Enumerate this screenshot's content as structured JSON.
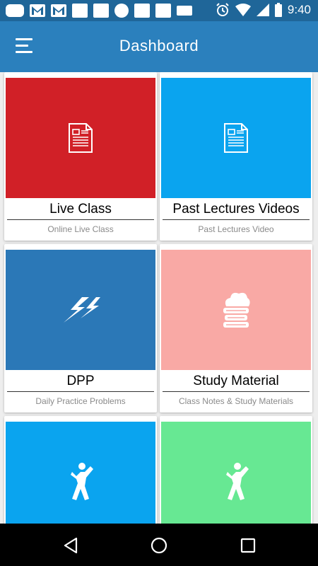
{
  "status_bar": {
    "time": "9:40",
    "notification_icons": [
      "chat-icon",
      "gmail-icon",
      "gmail-icon",
      "square-icon",
      "square-icon",
      "circle-icon",
      "square-icon",
      "square-icon",
      "square-icon"
    ],
    "system_icons": [
      "alarm-icon",
      "wifi-icon",
      "signal-icon",
      "battery-icon"
    ]
  },
  "app_bar": {
    "title": "Dashboard",
    "color": "#2b80bd"
  },
  "cards": [
    {
      "title": "Live Class",
      "subtitle": "Online Live Class",
      "color": "#d12027",
      "icon": "document-icon"
    },
    {
      "title": "Past Lectures Videos",
      "subtitle": "Past Lectures Video",
      "color": "#0aa4ef",
      "icon": "document-icon"
    },
    {
      "title": "DPP",
      "subtitle": "Daily Practice Problems",
      "color": "#2b78b7",
      "icon": "lightning-icon"
    },
    {
      "title": "Study Material",
      "subtitle": "Class Notes & Study Materials",
      "color": "#f9a9a5",
      "icon": "books-icon"
    },
    {
      "title": "",
      "subtitle": "",
      "color": "#0aa4ef",
      "icon": "person-icon"
    },
    {
      "title": "",
      "subtitle": "",
      "color": "#67e893",
      "icon": "person-icon"
    }
  ],
  "nav_bar": {
    "buttons": [
      "back-icon",
      "home-icon",
      "recents-icon"
    ]
  }
}
